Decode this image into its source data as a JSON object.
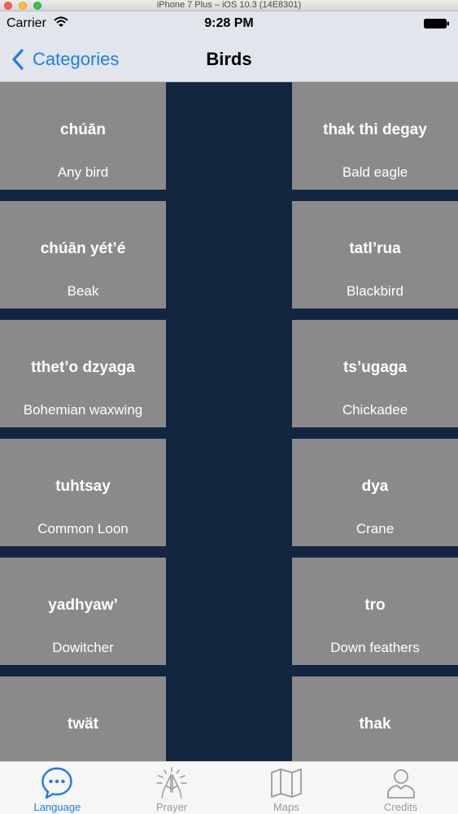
{
  "simulator": {
    "title": "iPhone 7 Plus – iOS 10.3 (14E8301)"
  },
  "status_bar": {
    "carrier": "Carrier",
    "time": "9:28 PM"
  },
  "nav": {
    "back_label": "Categories",
    "title": "Birds"
  },
  "colors": {
    "accent": "#1a7cf0",
    "tile": "#8a8a8a",
    "background": "#132640"
  },
  "grid": {
    "items": [
      {
        "term": "chúān",
        "meaning": "Any bird"
      },
      {
        "term": "thak thi degay",
        "meaning": "Bald eagle"
      },
      {
        "term": "chúān yét’é",
        "meaning": "Beak"
      },
      {
        "term": "tatl’rua",
        "meaning": "Blackbird"
      },
      {
        "term": "tthet’o dzyaga",
        "meaning": "Bohemian waxwing"
      },
      {
        "term": "ts’ugaga",
        "meaning": "Chickadee"
      },
      {
        "term": "tuhtsay",
        "meaning": "Common Loon"
      },
      {
        "term": "dya",
        "meaning": "Crane"
      },
      {
        "term": "yadhyaw’",
        "meaning": "Dowitcher"
      },
      {
        "term": "tro",
        "meaning": "Down feathers"
      },
      {
        "term": "twät",
        "meaning": ""
      },
      {
        "term": "thak",
        "meaning": ""
      }
    ]
  },
  "tabs": [
    {
      "label": "Language",
      "icon": "speech-bubble-icon",
      "active": true
    },
    {
      "label": "Prayer",
      "icon": "praying-hands-icon",
      "active": false
    },
    {
      "label": "Maps",
      "icon": "map-icon",
      "active": false
    },
    {
      "label": "Credits",
      "icon": "person-icon",
      "active": false
    }
  ]
}
